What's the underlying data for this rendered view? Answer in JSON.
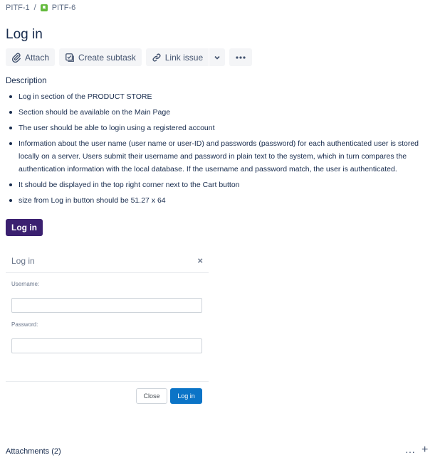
{
  "breadcrumb": {
    "parent": "PITF-1",
    "separator": "/",
    "current": "PITF-6"
  },
  "issue": {
    "title": "Log in"
  },
  "toolbar": {
    "attach_label": "Attach",
    "create_subtask_label": "Create subtask",
    "link_issue_label": "Link issue"
  },
  "description": {
    "heading": "Description",
    "items": [
      "Log in section of the PRODUCT STORE",
      "Section should be available on the Main Page",
      "The user should be able to login using a registered account",
      "Information about the user name (user name or user-ID) and passwords (password) for each authenticated user is stored locally on a server. Users submit their username and password in plain text to the system, which in turn compares the authentication information with the local database. If the username and password match, the user is authenticated.",
      "It should be displayed in the top right corner next to the Cart button",
      "size from Log in button should be 51.27 x 64"
    ]
  },
  "mockup": {
    "login_button_label": "Log in",
    "modal": {
      "title": "Log in",
      "close_glyph": "×",
      "username_label": "Username:",
      "password_label": "Password:",
      "close_button_label": "Close",
      "login_button_label": "Log in"
    }
  },
  "attachments": {
    "label": "Attachments (2)",
    "more_glyph": "···",
    "add_glyph": "+"
  },
  "colors": {
    "purple_button": "#3b2070",
    "primary_button": "#0b74c7",
    "story_icon": "#63ba3c"
  }
}
